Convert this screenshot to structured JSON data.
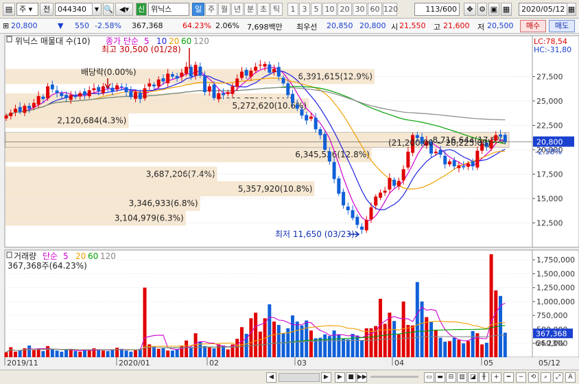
{
  "toolbar": {
    "type_label": "주",
    "prefix_label": "전",
    "code": "044340",
    "badge": "신",
    "stock_name": "위닉스",
    "periods": [
      "일",
      "주",
      "월",
      "년",
      "분",
      "초",
      "틱"
    ],
    "numbers": [
      "1",
      "3",
      "5",
      "10",
      "20",
      "30",
      "60",
      "120"
    ],
    "count": "113",
    "total": "/600",
    "date": "2020/05/12"
  },
  "quote": {
    "price": "20,800",
    "change": "550",
    "change_pct": "-2.58%",
    "volume": "367,368",
    "vol_ratio": "64.23%",
    "turnover": "2.06%",
    "amount": "7,698백만",
    "best_label": "최우선",
    "best_ask": "20,850",
    "best_bid": "20,800",
    "open_label": "시",
    "open": "21,550",
    "high_label": "고",
    "high": "21,600",
    "low_label": "저",
    "low": "20,500",
    "buy_label": "매수",
    "sell_label": "매도"
  },
  "price_panel": {
    "title": "위닉스 매물대 수(10)",
    "ma_label": "종가 단순",
    "ma_periods": [
      "5",
      "10",
      "20",
      "60",
      "120"
    ],
    "ma_colors": [
      "#d000d0",
      "#2020e0",
      "#f0a000",
      "#00a000",
      "#888888"
    ],
    "lc": "LC:78,54",
    "hc": "HC:-31,80",
    "price_tag": "20,800",
    "change_tag": "-2.58%",
    "high_note": "최고 30,500 (01/28)",
    "low_note": "최저 11,650 (03/23)",
    "dividend_note": "배당락(0.00%)",
    "range_note": "(21,200.00 ~ 20,225.00)"
  },
  "volume_panel": {
    "title": "거래량",
    "ma_label": "단순",
    "ma_periods": [
      "5",
      "20",
      "60",
      "120"
    ],
    "ma_colors": [
      "#d000d0",
      "#f0a000",
      "#00a000",
      "#888888"
    ],
    "summary": "367,368주(64.23%)",
    "tag": "367,368",
    "tag2": "64.23%"
  },
  "x_labels": [
    "2019/11",
    "2020/01",
    "02",
    "03",
    "04",
    "05",
    "05/12"
  ],
  "colors": {
    "up": "#e00000",
    "down": "#1060d8",
    "volume_profile": "#f5e6d0"
  },
  "chart_data": {
    "type": "candlestick",
    "price_axis": {
      "ticks": [
        12500,
        15000,
        17500,
        20000,
        22500,
        25000,
        27500
      ],
      "ylim": [
        10000,
        30700
      ]
    },
    "volume_axis": {
      "ticks": [
        250000,
        500000,
        750000,
        1000000,
        1250000,
        1500000,
        1750000
      ],
      "ylim": [
        0,
        1900000
      ]
    },
    "volume_profile": [
      {
        "price": 27500,
        "label": "6,391,615(12.9%)",
        "pct": 12.9
      },
      {
        "price": 25000,
        "label": "3,222,771(10.1%)",
        "pct": 10.1
      },
      {
        "price": 24500,
        "label": "5,272,620(10.6%)",
        "pct": 10.6
      },
      {
        "price": 23000,
        "label": "2,120,684(4.3%)",
        "pct": 4.3
      },
      {
        "price": 21000,
        "label": "8,716,644(17.6%)",
        "pct": 17.6
      },
      {
        "price": 19500,
        "label": "6,345,526(12.8%)",
        "pct": 12.8
      },
      {
        "price": 17500,
        "label": "3,687,206(7.4%)",
        "pct": 7.4
      },
      {
        "price": 16000,
        "label": "5,357,920(10.8%)",
        "pct": 10.8
      },
      {
        "price": 14500,
        "label": "3,346,933(6.8%)",
        "pct": 6.8
      },
      {
        "price": 13000,
        "label": "3,104,979(6.3%)",
        "pct": 6.3
      }
    ],
    "closes": [
      23500,
      23800,
      24200,
      23900,
      24500,
      24200,
      24800,
      25500,
      25200,
      26500,
      26200,
      25800,
      25500,
      25300,
      25600,
      25400,
      25800,
      25600,
      26100,
      26300,
      26000,
      26500,
      26300,
      26000,
      26600,
      26400,
      25900,
      25400,
      25900,
      25200,
      26300,
      26800,
      26500,
      27200,
      27000,
      27800,
      27500,
      27300,
      27900,
      28500,
      27500,
      28700,
      27600,
      25900,
      26500,
      25300,
      25800,
      25600,
      25900,
      26500,
      27300,
      28000,
      27600,
      28100,
      28500,
      28700,
      28800,
      27900,
      28300,
      27500,
      26800,
      25600,
      24800,
      24200,
      23500,
      23000,
      23400,
      22100,
      21500,
      20000,
      18800,
      17000,
      15500,
      14300,
      13800,
      13000,
      12300,
      11800,
      12800,
      14100,
      15200,
      15600,
      15800,
      17100,
      16300,
      16800,
      18000,
      19800,
      21500,
      21200,
      20600,
      20900,
      19600,
      19800,
      19500,
      18500,
      18800,
      18300,
      18400,
      18200,
      18600,
      18300,
      19900,
      20600,
      20300,
      21000,
      21500,
      21350,
      20800
    ],
    "volumes": [
      90000,
      180000,
      100000,
      120000,
      160000,
      210000,
      130000,
      150000,
      110000,
      200000,
      140000,
      120000,
      100000,
      130000,
      150000,
      110000,
      100000,
      140000,
      120000,
      160000,
      130000,
      120000,
      110000,
      140000,
      170000,
      150000,
      120000,
      100000,
      130000,
      150000,
      1250000,
      230000,
      190000,
      150000,
      160000,
      120000,
      120000,
      140000,
      210000,
      300000,
      180000,
      430000,
      280000,
      200000,
      190000,
      160000,
      230000,
      210000,
      140000,
      230000,
      330000,
      540000,
      420000,
      700000,
      800000,
      460000,
      700000,
      950000,
      640000,
      580000,
      430000,
      520000,
      750000,
      640000,
      570000,
      660000,
      480000,
      340000,
      350000,
      410000,
      380000,
      480000,
      410000,
      330000,
      320000,
      420000,
      390000,
      300000,
      520000,
      520000,
      560000,
      1050000,
      600000,
      800000,
      650000,
      410000,
      1000000,
      580000,
      570000,
      1350000,
      1000000,
      720000,
      640000,
      490000,
      350000,
      280000,
      290000,
      350000,
      310000,
      250000,
      290000,
      470000,
      430000,
      230000,
      260000,
      1850000,
      1200000,
      1100000,
      440000
    ]
  }
}
